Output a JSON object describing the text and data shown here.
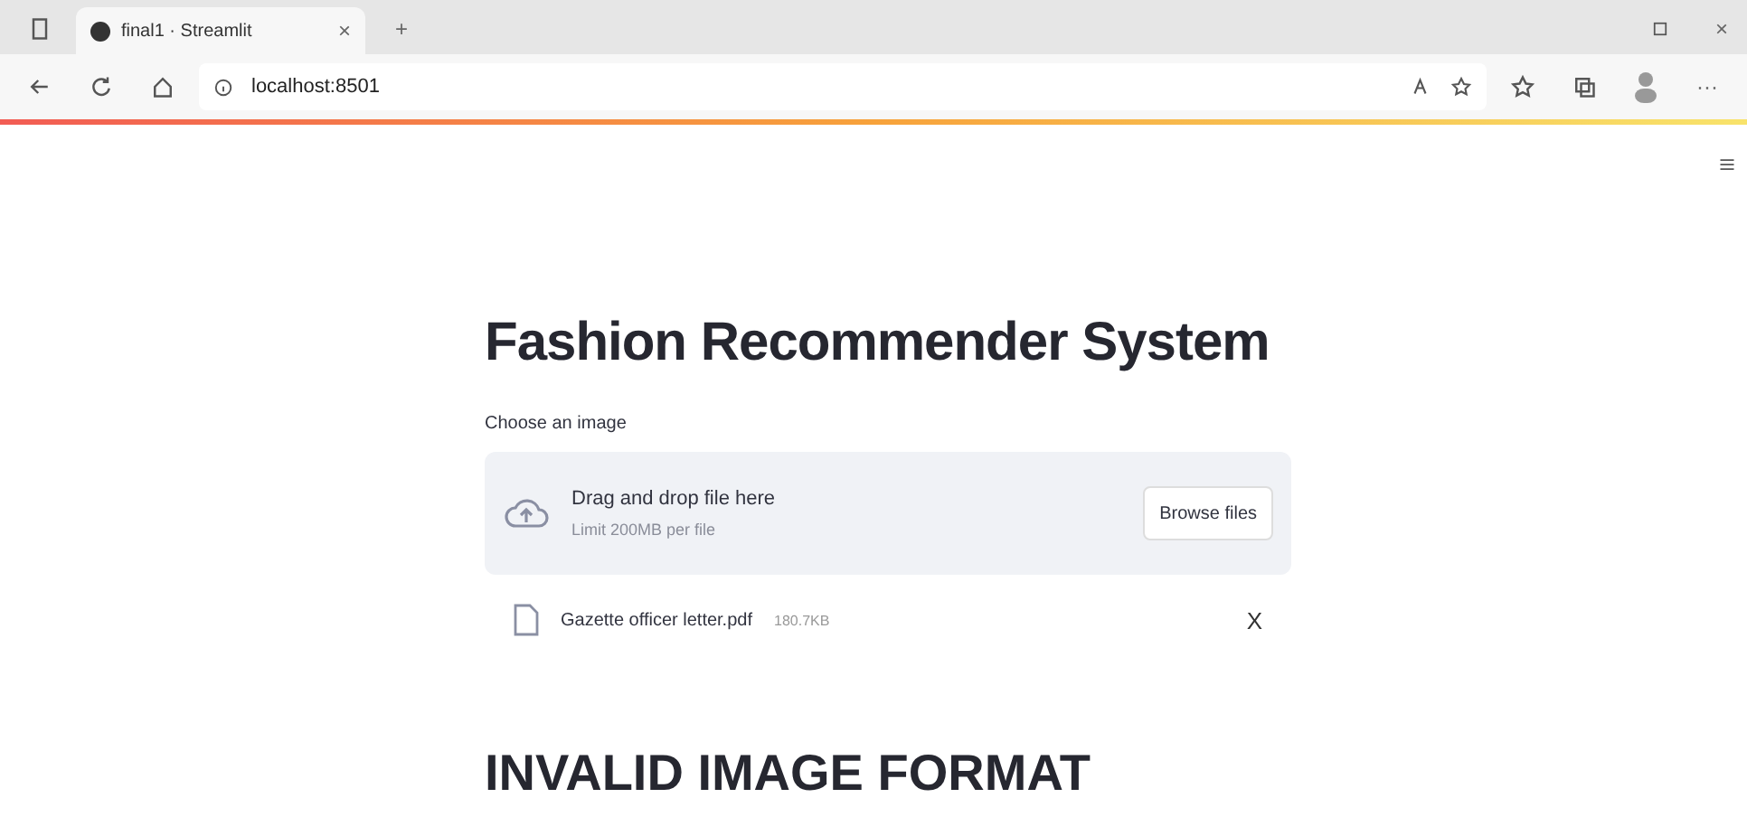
{
  "browser": {
    "tab_title": "final1 · Streamlit",
    "tab_close": "×",
    "new_tab": "+",
    "url": "localhost:8501",
    "window_close": "×",
    "more": "···"
  },
  "page": {
    "title": "Fashion Recommender System",
    "uploader_label": "Choose an image",
    "dropzone_text": "Drag and drop file here",
    "dropzone_limit": "Limit 200MB per file",
    "browse_button": "Browse files",
    "file": {
      "name": "Gazette officer letter.pdf",
      "size": "180.7KB",
      "remove": "X"
    },
    "message": "INVALID IMAGE FORMAT"
  }
}
